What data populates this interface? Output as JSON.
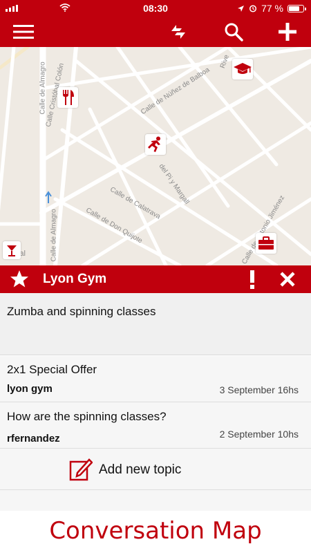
{
  "status_bar": {
    "time": "08:30",
    "battery": "77 %",
    "battery_level": 0.77
  },
  "colors": {
    "brand": "#c0000d",
    "map_bg": "#efeae3"
  },
  "toolbar": {
    "icons": [
      "menu-icon",
      "refresh-icon",
      "search-icon",
      "add-icon"
    ]
  },
  "map": {
    "streets": [
      "Calle de Almagro",
      "Calle Cristóbal Colón",
      "Calle de Núñez de Balboa",
      "del Pi y Margall",
      "Calle de Calatrava",
      "Calle de Don Quijote",
      "Calle de Almagro",
      "Calle de Antonio Jiménez",
      "Rive",
      "Legal"
    ],
    "pois": [
      "restaurant-icon",
      "gym-icon",
      "education-icon",
      "work-icon",
      "bar-icon"
    ]
  },
  "place": {
    "name": "Lyon Gym"
  },
  "description": "Zumba and spinning classes",
  "topics": [
    {
      "title": "2x1 Special Offer",
      "author": "lyon gym",
      "date": "3 September 16hs"
    },
    {
      "title": "How are the spinning classes?",
      "author": "rfernandez",
      "date": "2 September 10hs"
    }
  ],
  "add_topic_label": "Add new topic",
  "caption": "Conversation Map"
}
